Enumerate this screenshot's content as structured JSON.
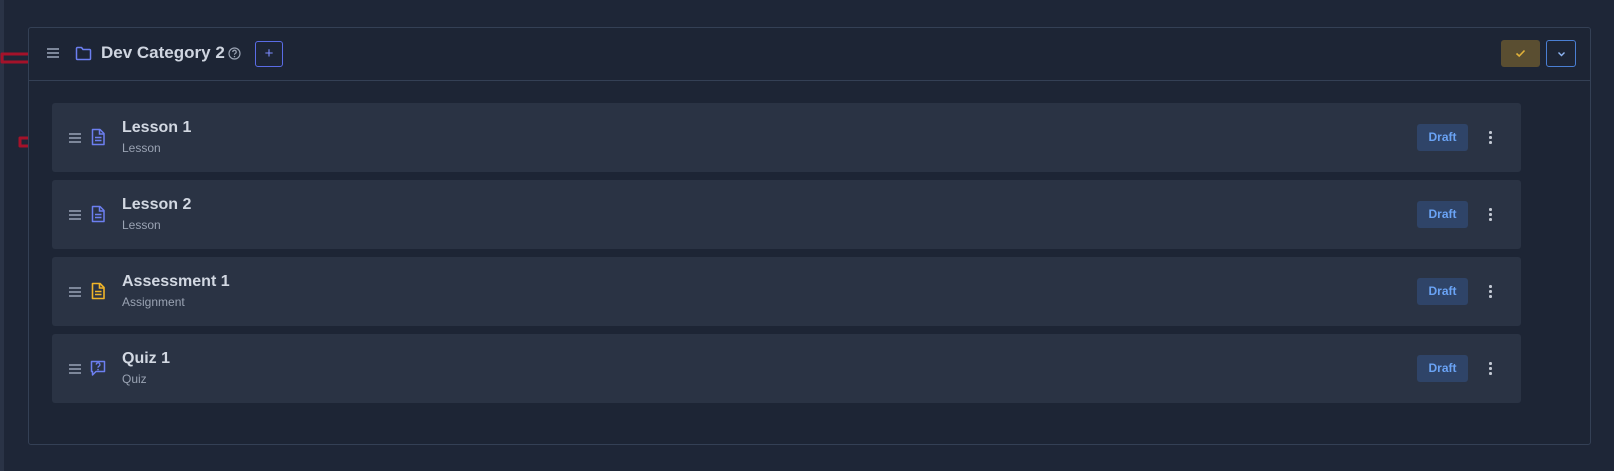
{
  "category": {
    "title": "Dev Category 2",
    "add_label": "+",
    "icons": {
      "drag": "drag-handle-icon",
      "folder": "folder-icon",
      "help": "help-circle-icon",
      "save": "check-icon",
      "collapse": "chevron-down-icon"
    }
  },
  "items": [
    {
      "title": "Lesson 1",
      "type": "Lesson",
      "status": "Draft",
      "icon": "document-icon"
    },
    {
      "title": "Lesson 2",
      "type": "Lesson",
      "status": "Draft",
      "icon": "document-icon"
    },
    {
      "title": "Assessment 1",
      "type": "Assignment",
      "status": "Draft",
      "icon": "assignment-icon"
    },
    {
      "title": "Quiz 1",
      "type": "Quiz",
      "status": "Draft",
      "icon": "quiz-icon"
    }
  ],
  "colors": {
    "background": "#1e2637",
    "item_background": "#2a3344",
    "accent": "#5a6ce6",
    "lesson_icon": "#6c7ff0",
    "assignment_icon": "#f0b429",
    "badge_text": "#6aa3f5",
    "annotation": "#a4122a"
  }
}
